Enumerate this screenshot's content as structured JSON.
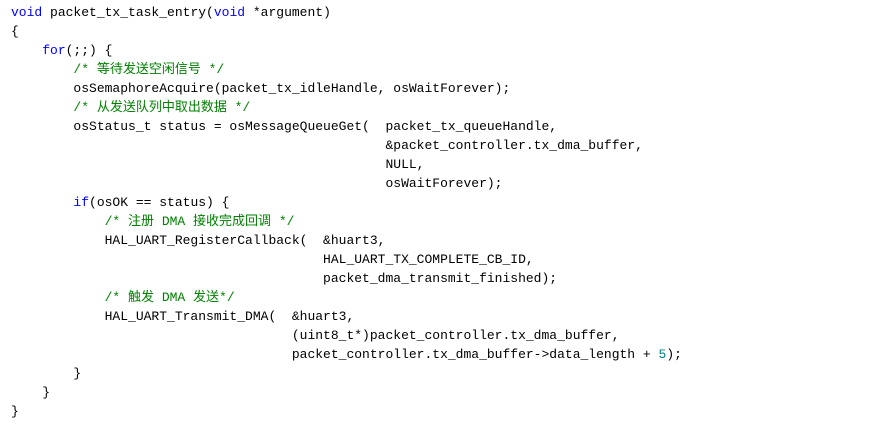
{
  "code": {
    "language": "c",
    "colors": {
      "text": "#000000",
      "keyword": "#0000ff",
      "comment": "#008000",
      "number": "#008080",
      "background": "#ffffff"
    },
    "lines": [
      {
        "tokens": [
          {
            "t": "kw",
            "v": "void"
          },
          {
            "t": "tx",
            "v": " packet_tx_task_entry("
          },
          {
            "t": "kw",
            "v": "void"
          },
          {
            "t": "tx",
            "v": " *argument)"
          }
        ]
      },
      {
        "tokens": [
          {
            "t": "tx",
            "v": "{"
          }
        ]
      },
      {
        "tokens": [
          {
            "t": "tx",
            "v": "    "
          },
          {
            "t": "kw",
            "v": "for"
          },
          {
            "t": "tx",
            "v": "(;;) {"
          }
        ]
      },
      {
        "tokens": [
          {
            "t": "tx",
            "v": "        "
          },
          {
            "t": "cm",
            "v": "/* 等待发送空闲信号 */"
          }
        ]
      },
      {
        "tokens": [
          {
            "t": "tx",
            "v": "        osSemaphoreAcquire(packet_tx_idleHandle, osWaitForever);"
          }
        ]
      },
      {
        "tokens": [
          {
            "t": "tx",
            "v": "        "
          },
          {
            "t": "cm",
            "v": "/* 从发送队列中取出数据 */"
          }
        ]
      },
      {
        "tokens": [
          {
            "t": "tx",
            "v": "        osStatus_t status = osMessageQueueGet(  packet_tx_queueHandle,"
          }
        ]
      },
      {
        "tokens": [
          {
            "t": "tx",
            "v": "                                                &packet_controller.tx_dma_buffer,"
          }
        ]
      },
      {
        "tokens": [
          {
            "t": "tx",
            "v": "                                                NULL,"
          }
        ]
      },
      {
        "tokens": [
          {
            "t": "tx",
            "v": "                                                osWaitForever);"
          }
        ]
      },
      {
        "tokens": [
          {
            "t": "tx",
            "v": "        "
          },
          {
            "t": "kw",
            "v": "if"
          },
          {
            "t": "tx",
            "v": "(osOK == status) {"
          }
        ]
      },
      {
        "tokens": [
          {
            "t": "tx",
            "v": "            "
          },
          {
            "t": "cm",
            "v": "/* 注册 DMA 接收完成回调 */"
          }
        ]
      },
      {
        "tokens": [
          {
            "t": "tx",
            "v": "            HAL_UART_RegisterCallback(  &huart3,"
          }
        ]
      },
      {
        "tokens": [
          {
            "t": "tx",
            "v": "                                        HAL_UART_TX_COMPLETE_CB_ID,"
          }
        ]
      },
      {
        "tokens": [
          {
            "t": "tx",
            "v": "                                        packet_dma_transmit_finished);"
          }
        ]
      },
      {
        "tokens": [
          {
            "t": "tx",
            "v": "            "
          },
          {
            "t": "cm",
            "v": "/* 触发 DMA 发送*/"
          }
        ]
      },
      {
        "tokens": [
          {
            "t": "tx",
            "v": "            HAL_UART_Transmit_DMA(  &huart3,"
          }
        ]
      },
      {
        "tokens": [
          {
            "t": "tx",
            "v": "                                    (uint8_t*)packet_controller.tx_dma_buffer,"
          }
        ]
      },
      {
        "tokens": [
          {
            "t": "tx",
            "v": "                                    packet_controller.tx_dma_buffer->data_length + "
          },
          {
            "t": "num",
            "v": "5"
          },
          {
            "t": "tx",
            "v": ");"
          }
        ]
      },
      {
        "tokens": [
          {
            "t": "tx",
            "v": "        }"
          }
        ]
      },
      {
        "tokens": [
          {
            "t": "tx",
            "v": "    }"
          }
        ]
      },
      {
        "tokens": [
          {
            "t": "tx",
            "v": "}"
          }
        ]
      }
    ]
  }
}
